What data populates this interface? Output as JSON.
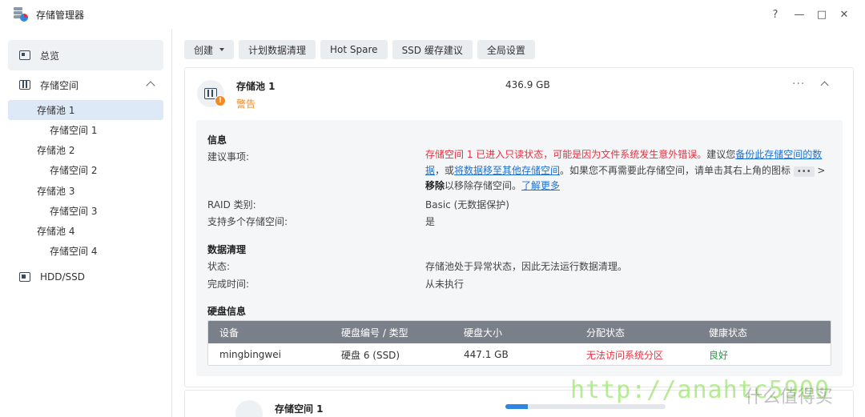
{
  "window": {
    "title": "存储管理器",
    "help": "?",
    "minimize": "—",
    "maximize": "□",
    "close": "✕"
  },
  "sidebar": {
    "overview": "总览",
    "group": "存储空间",
    "items": [
      {
        "label": "存储池 1",
        "type": "pool",
        "selected": true
      },
      {
        "label": "存储空间 1",
        "type": "volume"
      },
      {
        "label": "存储池 2",
        "type": "pool"
      },
      {
        "label": "存储空间 2",
        "type": "volume"
      },
      {
        "label": "存储池 3",
        "type": "pool"
      },
      {
        "label": "存储空间 3",
        "type": "volume"
      },
      {
        "label": "存储池 4",
        "type": "pool"
      },
      {
        "label": "存储空间 4",
        "type": "volume"
      }
    ],
    "hdd": "HDD/SSD"
  },
  "toolbar": {
    "create": "创建",
    "scrub": "计划数据清理",
    "hotspare": "Hot Spare",
    "ssd_cache": "SSD 缓存建议",
    "global": "全局设置"
  },
  "pool": {
    "name": "存储池 1",
    "status": "警告",
    "size": "436.9 GB",
    "more": "···",
    "warn_badge": "!"
  },
  "info": {
    "title": "信息",
    "advice_label": "建议事项:",
    "advice": {
      "red": "存储空间 1 已进入只读状态，可能是因为文件系统发生意外错误。",
      "t1": "建议您",
      "link1": "备份此存储空间的数据",
      "t2": "，或",
      "link2": "将数据移至其他存储空间",
      "t3": "。如果您不再需要此存储空间，请单击其右上角的图标",
      "chip": "•••",
      "t4": " > ",
      "bold": "移除",
      "t5": "以移除存储空间。",
      "link3": "了解更多"
    },
    "raid_label": "RAID 类别:",
    "raid_value": "Basic (无数据保护)",
    "multi_label": "支持多个存储空间:",
    "multi_value": "是"
  },
  "scrub": {
    "title": "数据清理",
    "status_label": "状态:",
    "status_value": "存储池处于异常状态，因此无法运行数据清理。",
    "time_label": "完成时间:",
    "time_value": "从未执行"
  },
  "disk": {
    "title": "硬盘信息",
    "headers": [
      "设备",
      "硬盘编号 / 类型",
      "硬盘大小",
      "分配状态",
      "健康状态"
    ],
    "rows": [
      [
        "mingbingwei",
        "硬盘 6 (SSD)",
        "447.1 GB",
        "无法访问系统分区",
        "良好"
      ]
    ]
  },
  "volume_card": {
    "name": "存储空间 1",
    "usage_fraction": 0.14
  },
  "watermark": {
    "url": "http://anahtc5900",
    "site": "什么值得买"
  },
  "colors": {
    "warning": "#f08a24",
    "error": "#e8303f",
    "link": "#1a72d6",
    "healthy": "#1ea042",
    "selected": "#dde9f6"
  }
}
